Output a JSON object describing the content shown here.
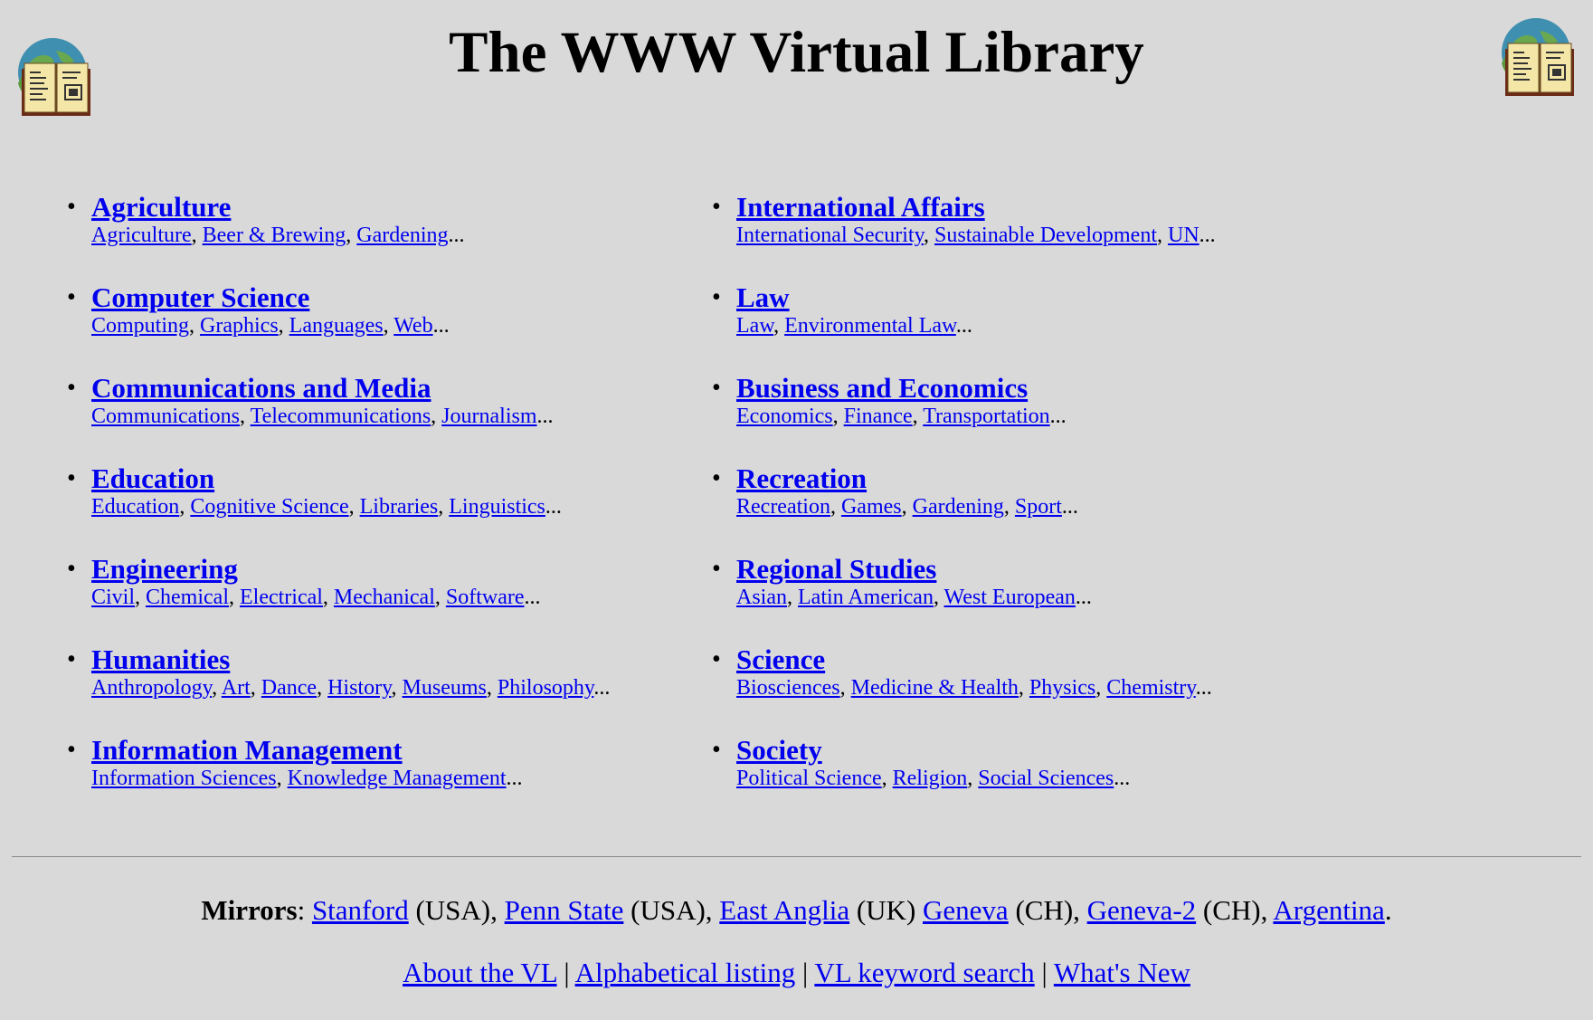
{
  "title": "The WWW Virtual Library",
  "logo_icon": "globe-book-icon",
  "left_column": [
    {
      "title": "Agriculture",
      "subs": [
        "Agriculture",
        "Beer & Brewing",
        "Gardening"
      ]
    },
    {
      "title": "Computer Science",
      "subs": [
        "Computing",
        "Graphics",
        "Languages",
        "Web"
      ]
    },
    {
      "title": "Communications and Media",
      "subs": [
        "Communications",
        "Telecommunications",
        "Journalism"
      ]
    },
    {
      "title": "Education",
      "subs": [
        "Education",
        "Cognitive Science",
        "Libraries",
        "Linguistics"
      ]
    },
    {
      "title": "Engineering",
      "subs": [
        "Civil",
        "Chemical",
        "Electrical",
        "Mechanical",
        "Software"
      ]
    },
    {
      "title": "Humanities",
      "subs": [
        "Anthropology",
        "Art",
        "Dance",
        "History",
        "Museums",
        "Philosophy"
      ]
    },
    {
      "title": "Information Management",
      "subs": [
        "Information Sciences",
        "Knowledge Management"
      ]
    }
  ],
  "right_column": [
    {
      "title": "International Affairs",
      "subs": [
        "International Security",
        "Sustainable Development",
        "UN"
      ]
    },
    {
      "title": "Law",
      "subs": [
        "Law",
        "Environmental Law"
      ]
    },
    {
      "title": "Business and Economics",
      "subs": [
        "Economics",
        "Finance",
        "Transportation"
      ]
    },
    {
      "title": "Recreation",
      "subs": [
        "Recreation",
        "Games",
        "Gardening",
        "Sport"
      ]
    },
    {
      "title": "Regional Studies",
      "subs": [
        "Asian",
        "Latin American",
        "West European"
      ]
    },
    {
      "title": "Science",
      "subs": [
        "Biosciences",
        "Medicine & Health",
        "Physics",
        "Chemistry"
      ]
    },
    {
      "title": "Society",
      "subs": [
        "Political Science",
        "Religion",
        "Social Sciences"
      ]
    }
  ],
  "ellipsis": "...",
  "mirrors": {
    "label": "Mirrors",
    "items": [
      {
        "name": "Stanford",
        "region": "(USA)",
        "sep": ", "
      },
      {
        "name": "Penn State",
        "region": "(USA)",
        "sep": ", "
      },
      {
        "name": "East Anglia",
        "region": "(UK)",
        "sep": " "
      },
      {
        "name": "Geneva",
        "region": "(CH)",
        "sep": ", "
      },
      {
        "name": "Geneva-2",
        "region": "(CH)",
        "sep": ", "
      },
      {
        "name": "Argentina",
        "region": "",
        "sep": "."
      }
    ]
  },
  "footer_links": [
    "About the VL",
    "Alphabetical listing",
    "VL keyword search",
    "What's New"
  ],
  "footer_separator": "|"
}
